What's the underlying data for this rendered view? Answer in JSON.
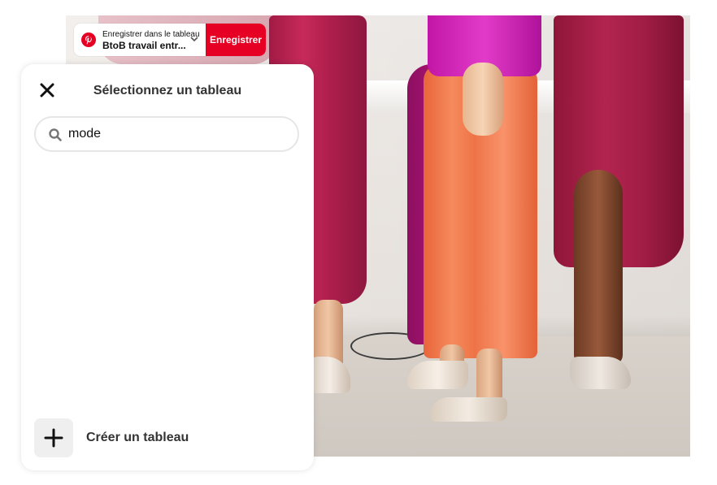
{
  "pin_image": {
    "description_icon": "fashion-photo"
  },
  "save_bar": {
    "logo_icon": "pinterest-logo-icon",
    "board_caption": "Enregistrer dans le tableau",
    "board_name": "BtoB travail entr...",
    "dropdown_icon": "chevron-down-icon",
    "save_label": "Enregistrer",
    "brand_color": "#e60023"
  },
  "board_picker": {
    "close_icon": "close-icon",
    "title": "Sélectionnez un tableau",
    "search": {
      "icon": "search-icon",
      "value": "mode"
    },
    "create": {
      "icon": "plus-icon",
      "label": "Créer un tableau"
    }
  }
}
